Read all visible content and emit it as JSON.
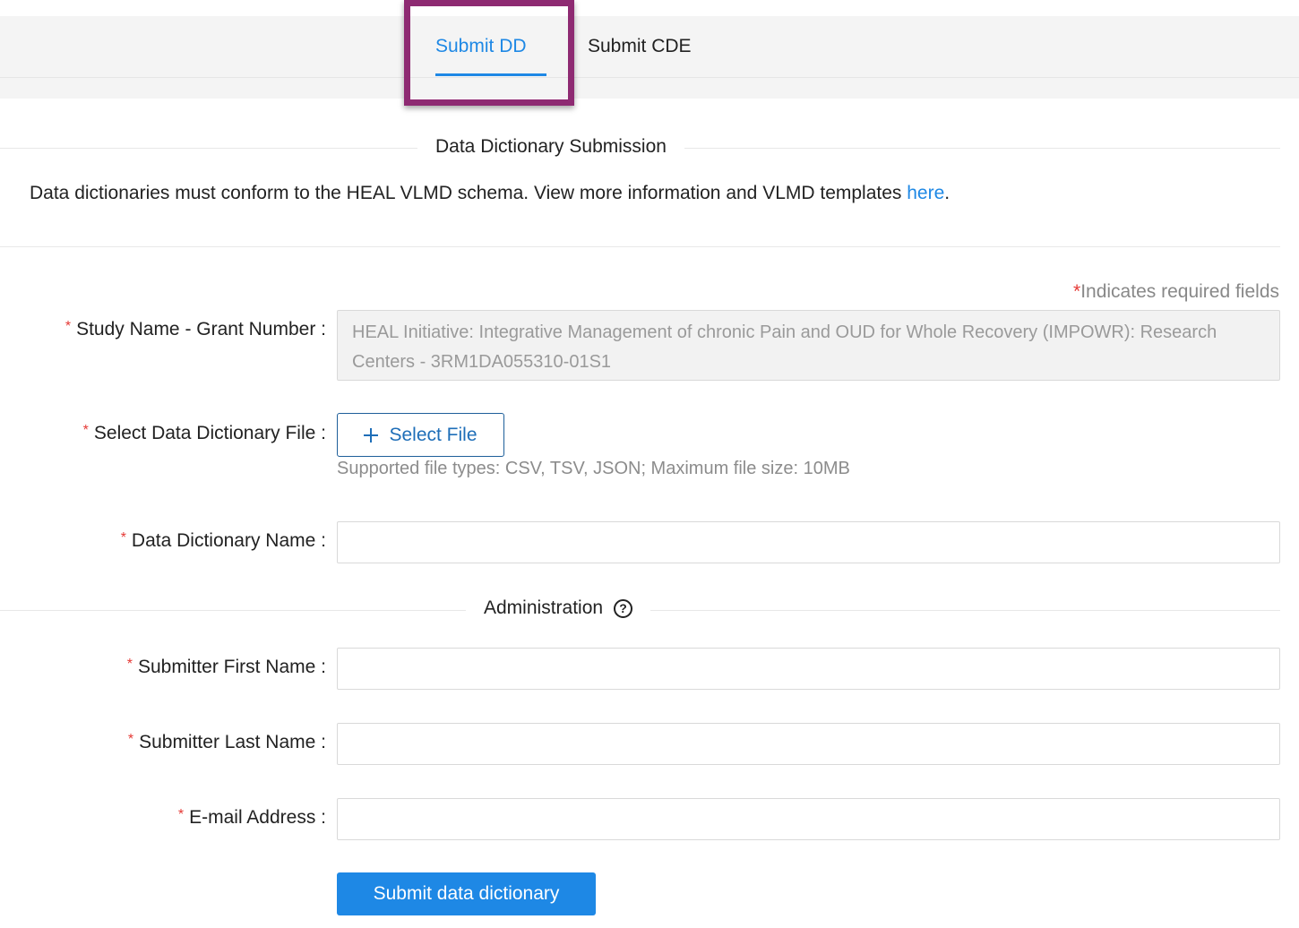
{
  "tabs": [
    {
      "label": "Submit DD",
      "active": true
    },
    {
      "label": "Submit CDE",
      "active": false
    }
  ],
  "section_title": "Data Dictionary Submission",
  "intro": {
    "text": "Data dictionaries must conform to the HEAL VLMD schema. View more information and VLMD templates ",
    "link": "here",
    "end": "."
  },
  "required_note": {
    "star": "*",
    "text": "Indicates required fields"
  },
  "fields": {
    "study": {
      "label": "Study Name - Grant Number",
      "value": "HEAL Initiative: Integrative Management of chronic Pain and OUD for Whole Recovery (IMPOWR): Research Centers - 3RM1DA055310-01S1"
    },
    "file": {
      "label": "Select Data Dictionary File",
      "button": "Select File",
      "hint": "Supported file types: CSV, TSV, JSON; Maximum file size: 10MB"
    },
    "dd_name": {
      "label": "Data Dictionary Name",
      "value": ""
    },
    "first_name": {
      "label": "Submitter First Name",
      "value": ""
    },
    "last_name": {
      "label": "Submitter Last Name",
      "value": ""
    },
    "email": {
      "label": "E-mail Address",
      "value": ""
    }
  },
  "admin_title": "Administration",
  "submit_label": "Submit data dictionary",
  "colors": {
    "accent": "#1e88e5",
    "required": "#e53935",
    "highlight": "#8e2a72"
  }
}
